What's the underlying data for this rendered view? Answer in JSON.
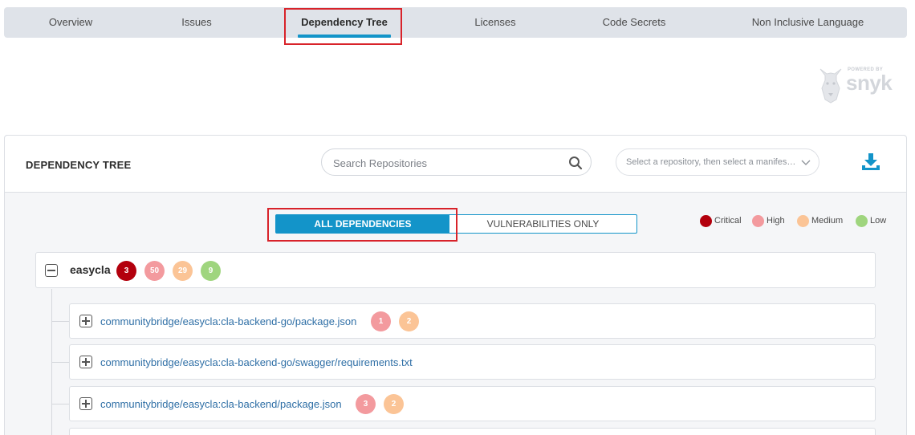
{
  "nav": {
    "tabs": [
      {
        "label": "Overview"
      },
      {
        "label": "Issues"
      },
      {
        "label": "Dependency Tree",
        "active": true
      },
      {
        "label": "Licenses"
      },
      {
        "label": "Code Secrets"
      },
      {
        "label": "Non Inclusive Language"
      }
    ]
  },
  "logo": {
    "powered": "POWERED BY",
    "word": "snyk"
  },
  "panel": {
    "title": "DEPENDENCY TREE",
    "search_placeholder": "Search Repositories",
    "select_placeholder": "Select a repository, then select a manifes…",
    "toggle": {
      "all": "ALL DEPENDENCIES",
      "vuln": "VULNERABILITIES ONLY",
      "selected": "all"
    },
    "legend": [
      {
        "label": "Critical",
        "color": "#b3000d"
      },
      {
        "label": "High",
        "color": "#f39a9e"
      },
      {
        "label": "Medium",
        "color": "#fbc496"
      },
      {
        "label": "Low",
        "color": "#9fd57e"
      }
    ]
  },
  "tree": {
    "root": {
      "label": "easycla",
      "counts": {
        "critical": "3",
        "high": "50",
        "medium": "29",
        "low": "9"
      }
    },
    "children": [
      {
        "path": "communitybridge/easycla:cla-backend-go/package.json",
        "high": "1",
        "medium": "2"
      },
      {
        "path": "communitybridge/easycla:cla-backend-go/swagger/requirements.txt"
      },
      {
        "path": "communitybridge/easycla:cla-backend/package.json",
        "high": "3",
        "medium": "2"
      }
    ]
  }
}
